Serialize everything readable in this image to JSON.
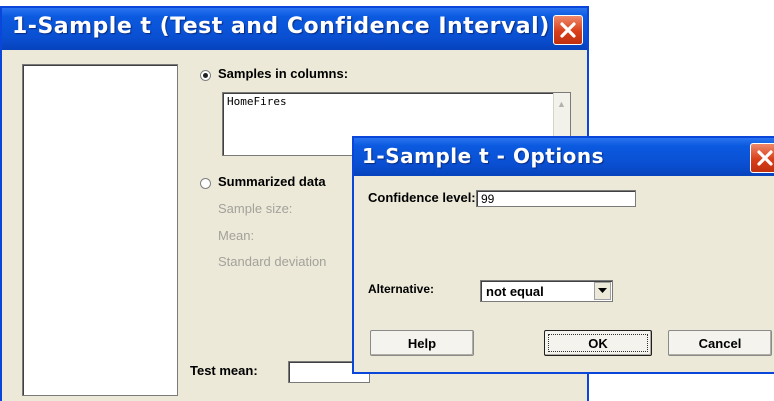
{
  "main_dialog": {
    "title": "1-Sample t (Test and Confidence Interval)",
    "samples_in_columns_label": "Samples in columns:",
    "samples_in_columns_value": "HomeFires",
    "summarized_data_label": "Summarized data",
    "sample_size_label": "Sample size:",
    "mean_label": "Mean:",
    "std_dev_label": "Standard deviation",
    "test_mean_label": "Test mean:",
    "test_mean_value": "",
    "selected_option": "Samples in columns"
  },
  "options_dialog": {
    "title": "1-Sample t - Options",
    "confidence_level_label": "Confidence level:",
    "confidence_level_value": "99",
    "alternative_label": "Alternative:",
    "alternative_value": "not equal",
    "help_label": "Help",
    "ok_label": "OK",
    "cancel_label": "Cancel"
  },
  "icons": {
    "close": "close-icon",
    "scroll_up": "scroll-up-icon",
    "scroll_down": "scroll-down-icon",
    "dropdown": "chevron-down-icon"
  },
  "colors": {
    "titlebar": "#0a4fd2",
    "close_button": "#d8401a",
    "dialog_bg": "#ece9d8"
  }
}
